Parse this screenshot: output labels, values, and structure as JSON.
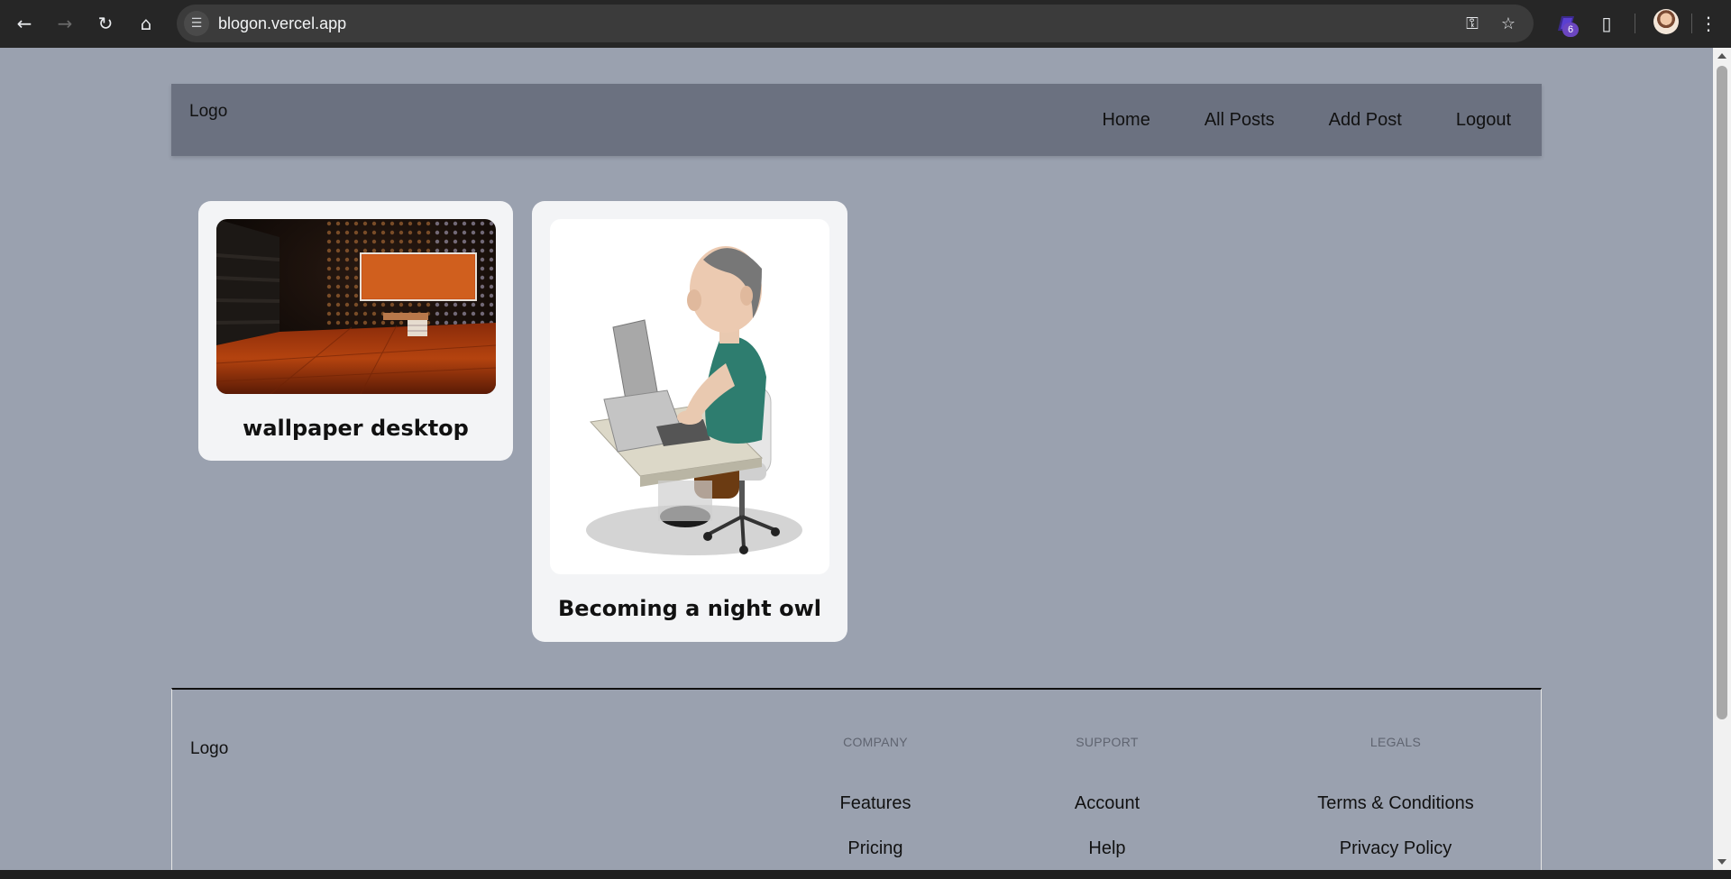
{
  "browser": {
    "url": "blogon.vercel.app",
    "extension_badge": "6"
  },
  "header": {
    "logo": "Logo",
    "nav": [
      "Home",
      "All Posts",
      "Add Post",
      "Logout"
    ]
  },
  "posts": [
    {
      "title": "wallpaper desktop",
      "image": "room-wallpaper-image"
    },
    {
      "title": "Becoming a night owl",
      "image": "man-at-computer-image"
    }
  ],
  "footer": {
    "logo": "Logo",
    "columns": [
      {
        "heading": "COMPANY",
        "links": [
          "Features",
          "Pricing"
        ]
      },
      {
        "heading": "SUPPORT",
        "links": [
          "Account",
          "Help"
        ]
      },
      {
        "heading": "LEGALS",
        "links": [
          "Terms & Conditions",
          "Privacy Policy"
        ]
      }
    ]
  },
  "colors": {
    "page_bg": "#9aa1af",
    "header_bg": "#6b7180",
    "card_bg": "#f3f4f6",
    "chrome_bg": "#262626"
  }
}
